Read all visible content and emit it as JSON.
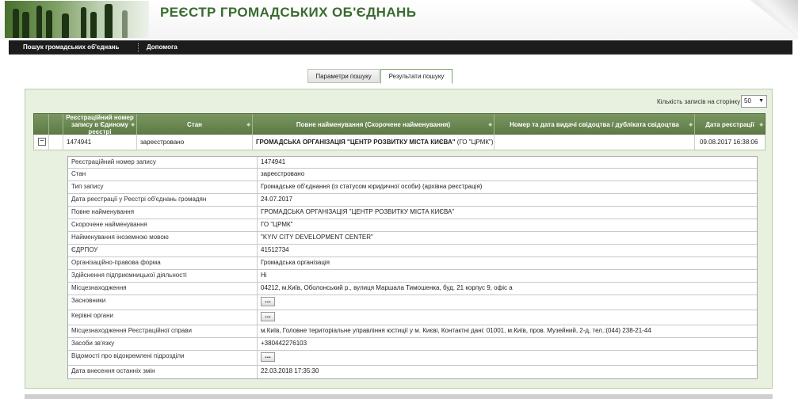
{
  "header": {
    "title": "РЕЄСТР ГРОМАДСЬКИХ ОБ'ЄДНАНЬ"
  },
  "nav": {
    "search": "Пошук громадських об'єднань",
    "help": "Допомога"
  },
  "tabs": [
    {
      "label": "Параметри пошуку",
      "active": false
    },
    {
      "label": "Результати пошуку",
      "active": true
    }
  ],
  "results_per_page": {
    "label": "Кількість записів на сторінку",
    "value": "50"
  },
  "grid": {
    "columns": [
      "Реєстраційний номер запису в Єдиному реєстрі",
      "Стан",
      "Повне найменування (Скорочене найменування)",
      "Номер та дата видачі свідоцтва / дубліката свідоцтва",
      "Дата реєстрації"
    ],
    "row": {
      "reg_no": "1474941",
      "status": "зареєстровано",
      "name_bold": "ГРОМАДСЬКА ОРГАНІЗАЦІЯ \"ЦЕНТР РОЗВИТКУ МІСТА КИЄВА\"",
      "name_short": " (ГО \"ЦРМК\")",
      "certificate": "",
      "reg_date": "09.08.2017 16:38:06"
    }
  },
  "details": [
    {
      "label": "Реєстраційний номер запису",
      "value": "1474941"
    },
    {
      "label": "Стан",
      "value": "зареєстровано"
    },
    {
      "label": "Тип запису",
      "value": "Громадське об'єднання (із статусом юридичної особи) (архівна реєстрація)"
    },
    {
      "label": "Дата реєстрації у Реєстрі об'єднань громадян",
      "value": "24.07.2017"
    },
    {
      "label": "Повне найменування",
      "value": "ГРОМАДСЬКА ОРГАНІЗАЦІЯ \"ЦЕНТР РОЗВИТКУ МІСТА КИЄВА\""
    },
    {
      "label": "Скорочене найменування",
      "value": "ГО \"ЦРМК\""
    },
    {
      "label": "Найменування іноземною мовою",
      "value": "\"KYIV CITY DEVELOPMENT CENTER\""
    },
    {
      "label": "ЄДРПОУ",
      "value": "41512734"
    },
    {
      "label": "Організаційно-правова форма",
      "value": "Громадська організація"
    },
    {
      "label": "Здійснення підприємницької діяльності",
      "value": "Ні"
    },
    {
      "label": "Місцезнаходження",
      "value": "04212, м.Київ, Оболонський р., вулиця Маршала Тимошенка, буд. 21 корпус 9, офіс а"
    },
    {
      "label": "Засновники",
      "value": "...",
      "button": true
    },
    {
      "label": "Керівні органи",
      "value": "...",
      "button": true
    },
    {
      "label": "Місцезнаходження Реєстраційної справи",
      "value": "м.Київ, Головне територіальне управління юстиції у м. Києві, Контактні дані: 01001, м.Київ, пров. Музейний, 2-д, тел.:(044) 238-21-44"
    },
    {
      "label": "Засоби зв'язку",
      "value": "+380442276103"
    },
    {
      "label": "Відомості про відокремлені підрозділи",
      "value": "...",
      "button": true
    },
    {
      "label": "Дата внесення останніх змін",
      "value": "22.03.2018 17:35:30"
    }
  ]
}
